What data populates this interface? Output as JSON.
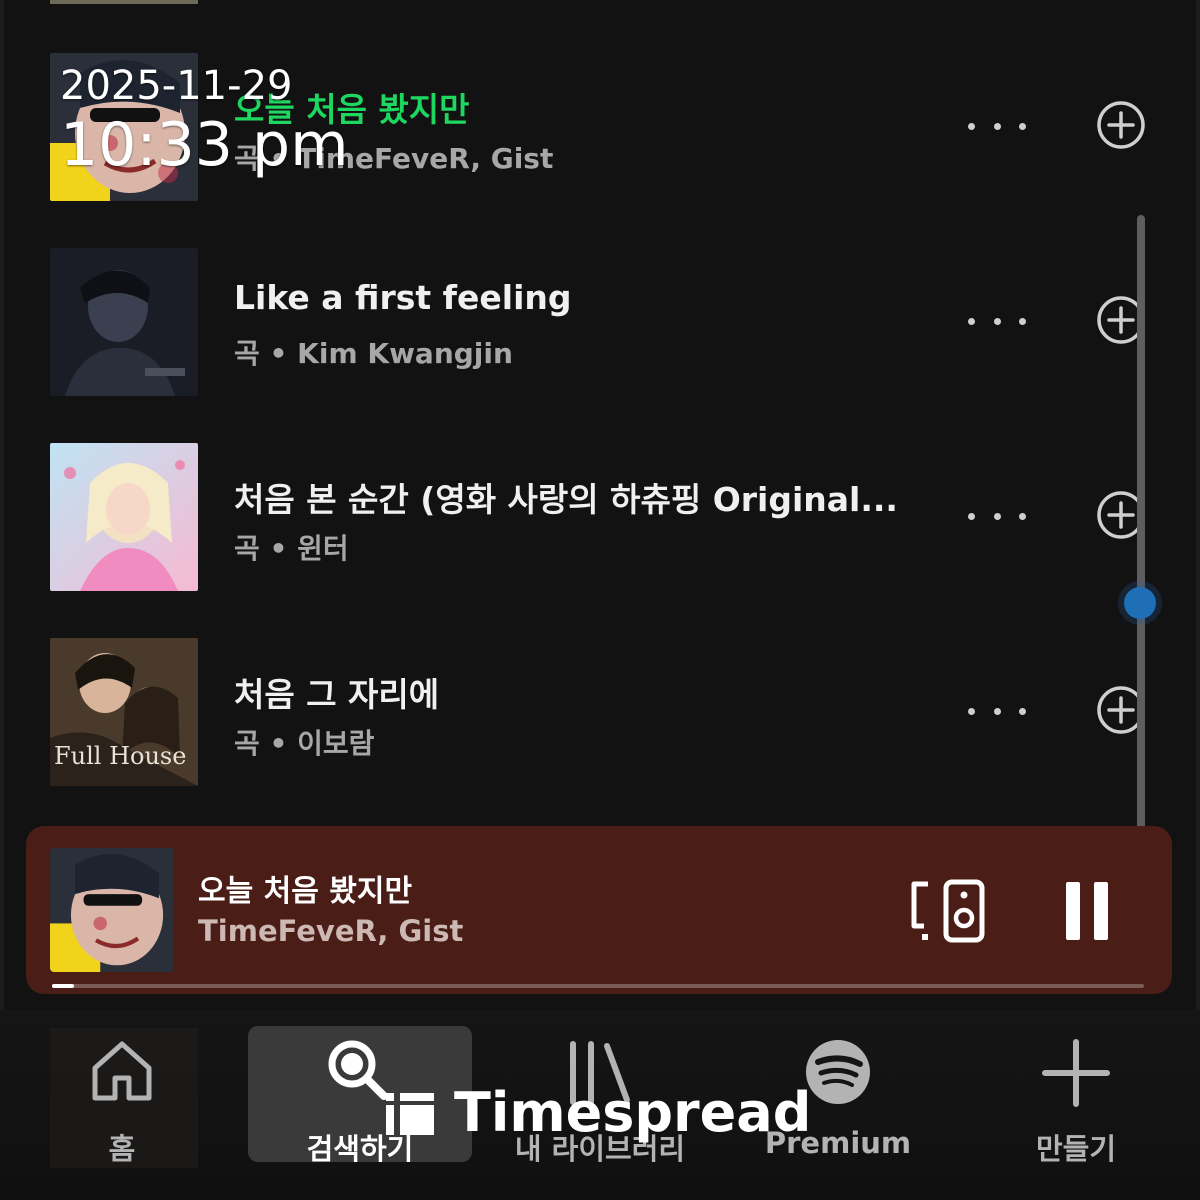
{
  "track_list": {
    "tracks": [
      {
        "title": "오늘 처음 봤지만",
        "subtitle": "곡 • TimeFeveR, Gist",
        "playing": true,
        "art_colors": [
          "#f2d31b",
          "#2a2f3a"
        ]
      },
      {
        "title": "Like a first feeling",
        "subtitle": "곡 • Kim Kwangjin",
        "playing": false,
        "art_colors": [
          "#1a1d26",
          "#3b4050"
        ]
      },
      {
        "title": "처음 본 순간 (영화 사랑의 하츄핑 Original...",
        "subtitle": "곡 • 윈터",
        "playing": false,
        "art_colors": [
          "#f6b9d2",
          "#bfe3f3"
        ]
      },
      {
        "title": "처음 그 자리에",
        "subtitle": "곡 • 이보람",
        "playing": false,
        "art_colors": [
          "#5a4636",
          "#2c2620"
        ],
        "art_text": "Full House"
      }
    ]
  },
  "timestamp": {
    "date": "2025-11-29",
    "time": "10:33 pm"
  },
  "mini_player": {
    "title": "오늘 처음 봤지만",
    "artist": "TimeFeveR, Gist",
    "progress_fraction": 0.02,
    "background": "#4a1d16"
  },
  "bottom_nav": {
    "items": [
      {
        "label": "홈",
        "icon": "home-icon",
        "active": false
      },
      {
        "label": "검색하기",
        "icon": "search-icon",
        "active": true
      },
      {
        "label": "내 라이브러리",
        "icon": "library-icon",
        "active": false
      },
      {
        "label": "Premium",
        "icon": "spotify-icon",
        "active": false
      },
      {
        "label": "만들기",
        "icon": "plus-icon",
        "active": false
      }
    ]
  },
  "watermark": {
    "text": "Timespread"
  },
  "colors": {
    "accent": "#1ed760",
    "background": "#121212",
    "scroll_thumb": "#1f6fb7"
  }
}
